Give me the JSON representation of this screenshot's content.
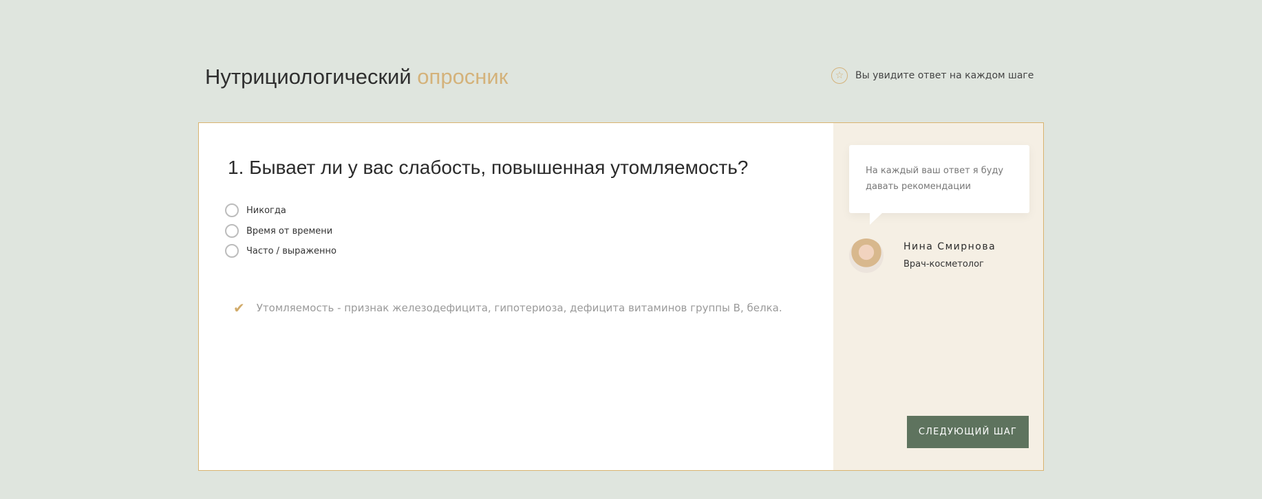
{
  "header": {
    "title_main": "Нутрициологический",
    "title_accent": "опросник",
    "note": "Вы увидите ответ на каждом шаге",
    "note_icon": "star-icon"
  },
  "quiz": {
    "question": "1. Бывает ли у вас слабость, повышенная утомляемость?",
    "options": [
      {
        "label": "Никогда"
      },
      {
        "label": "Время от времени"
      },
      {
        "label": "Часто / выраженно"
      }
    ],
    "hint": "Утомляемость - признак железодефицита, гипотериоза, дефицита витаминов группы В, белка."
  },
  "sidebar": {
    "bubble_text": "На каждый ваш ответ я буду давать рекомендации",
    "expert_name": "Нина Смирнова",
    "expert_role": "Врач-косметолог",
    "next_label": "СЛЕДУЮЩИЙ ШАГ"
  },
  "colors": {
    "accent": "#d4b27a",
    "button": "#5e735e",
    "background": "#dfe5de",
    "side_panel": "#f5efe4"
  }
}
